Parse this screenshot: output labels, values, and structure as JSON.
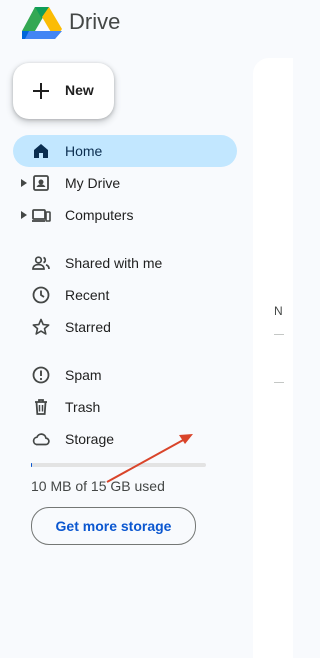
{
  "app": {
    "name": "Drive"
  },
  "new_button": {
    "label": "New"
  },
  "nav": {
    "items": [
      {
        "label": "Home",
        "icon": "home-icon",
        "active": true
      },
      {
        "label": "My Drive",
        "icon": "my-drive-icon",
        "expandable": true
      },
      {
        "label": "Computers",
        "icon": "computers-icon",
        "expandable": true
      },
      {
        "label": "Shared with me",
        "icon": "shared-icon"
      },
      {
        "label": "Recent",
        "icon": "clock-icon"
      },
      {
        "label": "Starred",
        "icon": "star-icon"
      },
      {
        "label": "Spam",
        "icon": "spam-icon"
      },
      {
        "label": "Trash",
        "icon": "trash-icon"
      },
      {
        "label": "Storage",
        "icon": "cloud-icon"
      }
    ]
  },
  "storage": {
    "used_text": "10 MB of 15 GB used",
    "used_fraction": 0.001,
    "cta_label": "Get more storage"
  },
  "main_panel": {
    "partial_text": "N"
  },
  "colors": {
    "active_bg": "#c2e7ff",
    "accent": "#0b57d0",
    "annotation_arrow": "#d9442a",
    "sidebar_bg": "#f8fafd"
  }
}
